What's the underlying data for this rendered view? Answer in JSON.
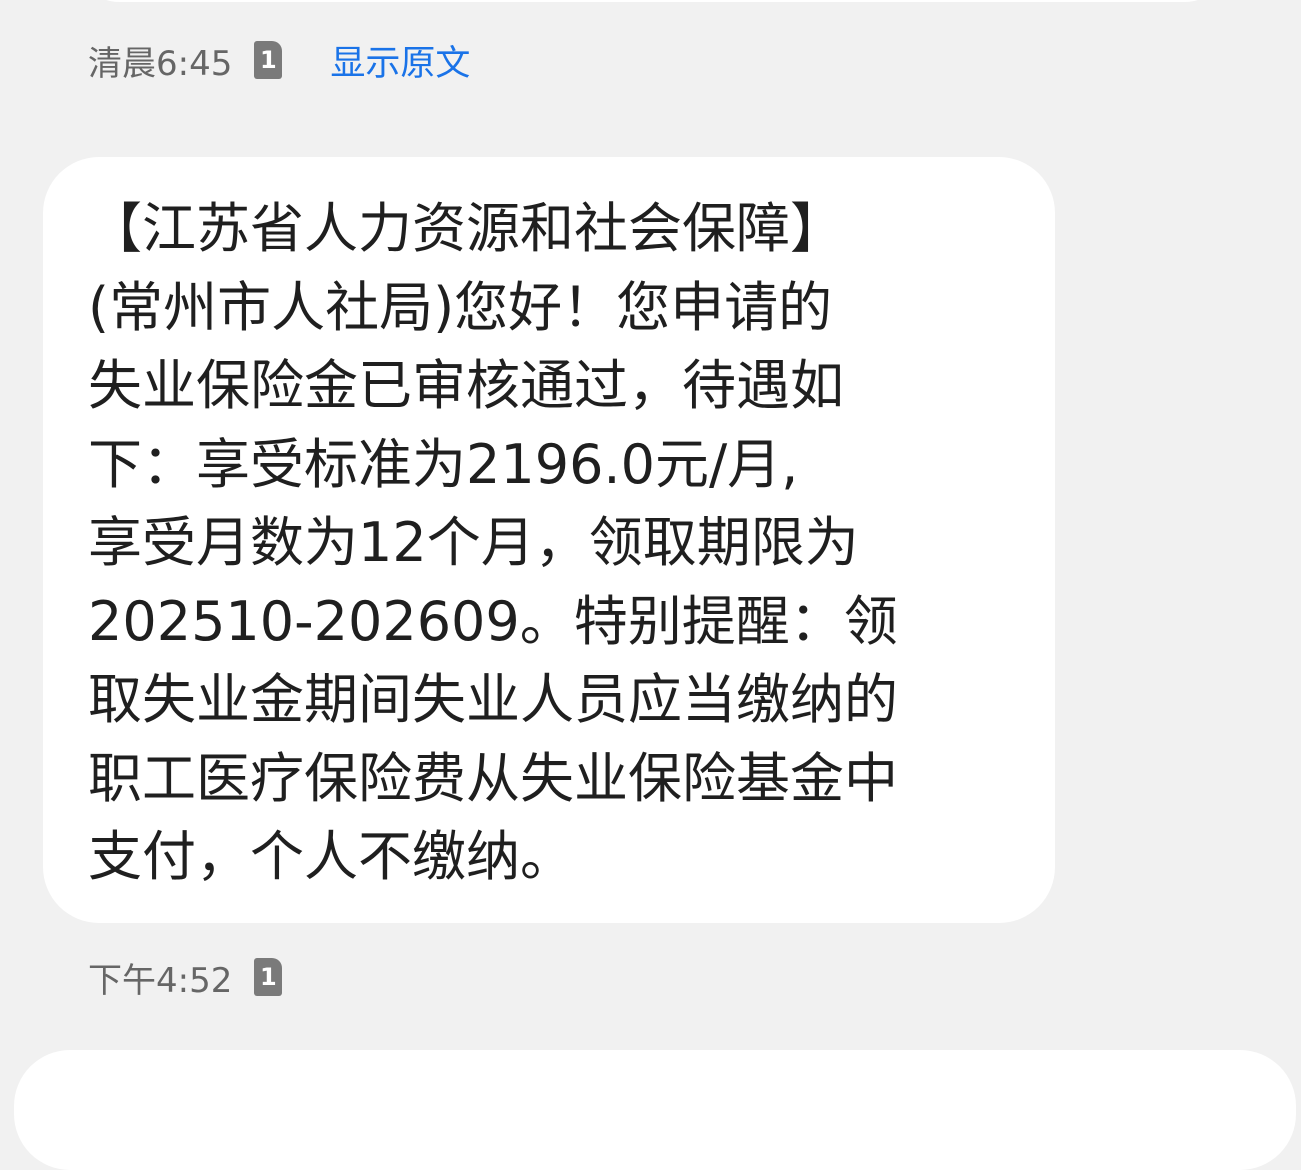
{
  "messages": [
    {
      "time": "清晨6:45",
      "sim": "1",
      "action": "显示原文"
    },
    {
      "lines": [
        "【江苏省人力资源和社会保障】",
        "(常州市人社局)您好！您申请的",
        "失业保险金已审核通过，待遇如",
        "下：享受标准为2196.0元/月,",
        "享受月数为12个月，领取期限为",
        "202510-202609。特别提醒：领",
        "取失业金期间失业人员应当缴纳的",
        "职工医疗保险费从失业保险基金中",
        "支付，个人不缴纳。"
      ],
      "time": "下午4:52",
      "sim": "1"
    }
  ]
}
